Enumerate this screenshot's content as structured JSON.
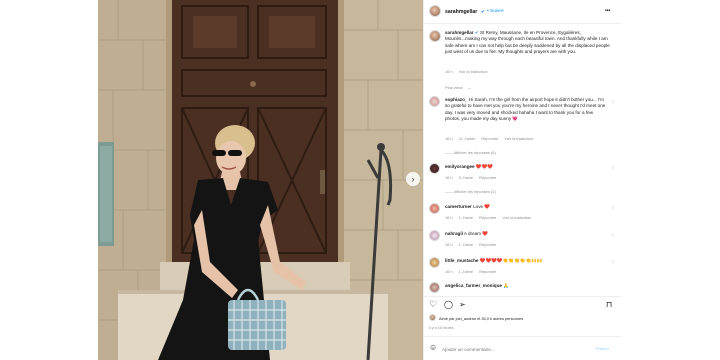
{
  "post": {
    "username": "sarahmgellar",
    "follow_label": "• Suivre",
    "more": "•••"
  },
  "caption": {
    "username": "sarahmgellar",
    "text": "St Remy, Maussane, Ile en Provence, Eygalières, Mouriès...making my way through each beautiful town. And thankfully while I am safe where am I can not help but be deeply saddened by all the displaced people just west of us due to fire. My thoughts and prayers are with you.",
    "time": "16 h",
    "translation": "Voir la traduction"
  },
  "edited_label": "Plus vieux",
  "comments": [
    {
      "user": "sophiazo_",
      "text": "Hi Sarah, I'm the girl from the airport hope it didn't bother you... I'm so grateful to have met you you're my heroine and I never thought I'd meet one day. I was very moved and shocked hahaha I want to thank you for a few photos, you made my day sunny 💗",
      "time": "16 h",
      "likes": "21 J'aime",
      "reply": "Répondre",
      "translation": "Voir la traduction",
      "replies": "—— Afficher les réponses (6)"
    },
    {
      "user": "emilyorangee",
      "text": "❤️❤️❤️",
      "time": "16 h",
      "likes": "5 J'aime",
      "reply": "Répondre",
      "replies": "—— Afficher les réponses (2)"
    },
    {
      "user": "camerturner",
      "text": "Love ❤️",
      "time": "16 h",
      "likes": "1 J'aime",
      "reply": "Répondre",
      "translation": "Voir la traduction"
    },
    {
      "user": "nahragil",
      "text": "A dream ❤️",
      "time": "16 h",
      "likes": "1 J'aime",
      "reply": "Répondre"
    },
    {
      "user": "little_mustache",
      "text": "❤️❤️❤️❤️👏👏👏👏👏🙌🙌",
      "time": "16 h",
      "likes": "1 J'aime",
      "reply": "Répondre"
    },
    {
      "user": "angelica_farmer_monique",
      "text": "🙏"
    }
  ],
  "likes_line": "Aimé par joel_audran et 35,0 k autres personnes",
  "date": "Il y a 16 heures",
  "comment_input": {
    "placeholder": "Ajouter un commentaire...",
    "publish": "Publier"
  },
  "icons": {
    "like": "heart-icon",
    "comment": "comment-icon",
    "share": "send-icon",
    "save": "bookmark-icon"
  }
}
